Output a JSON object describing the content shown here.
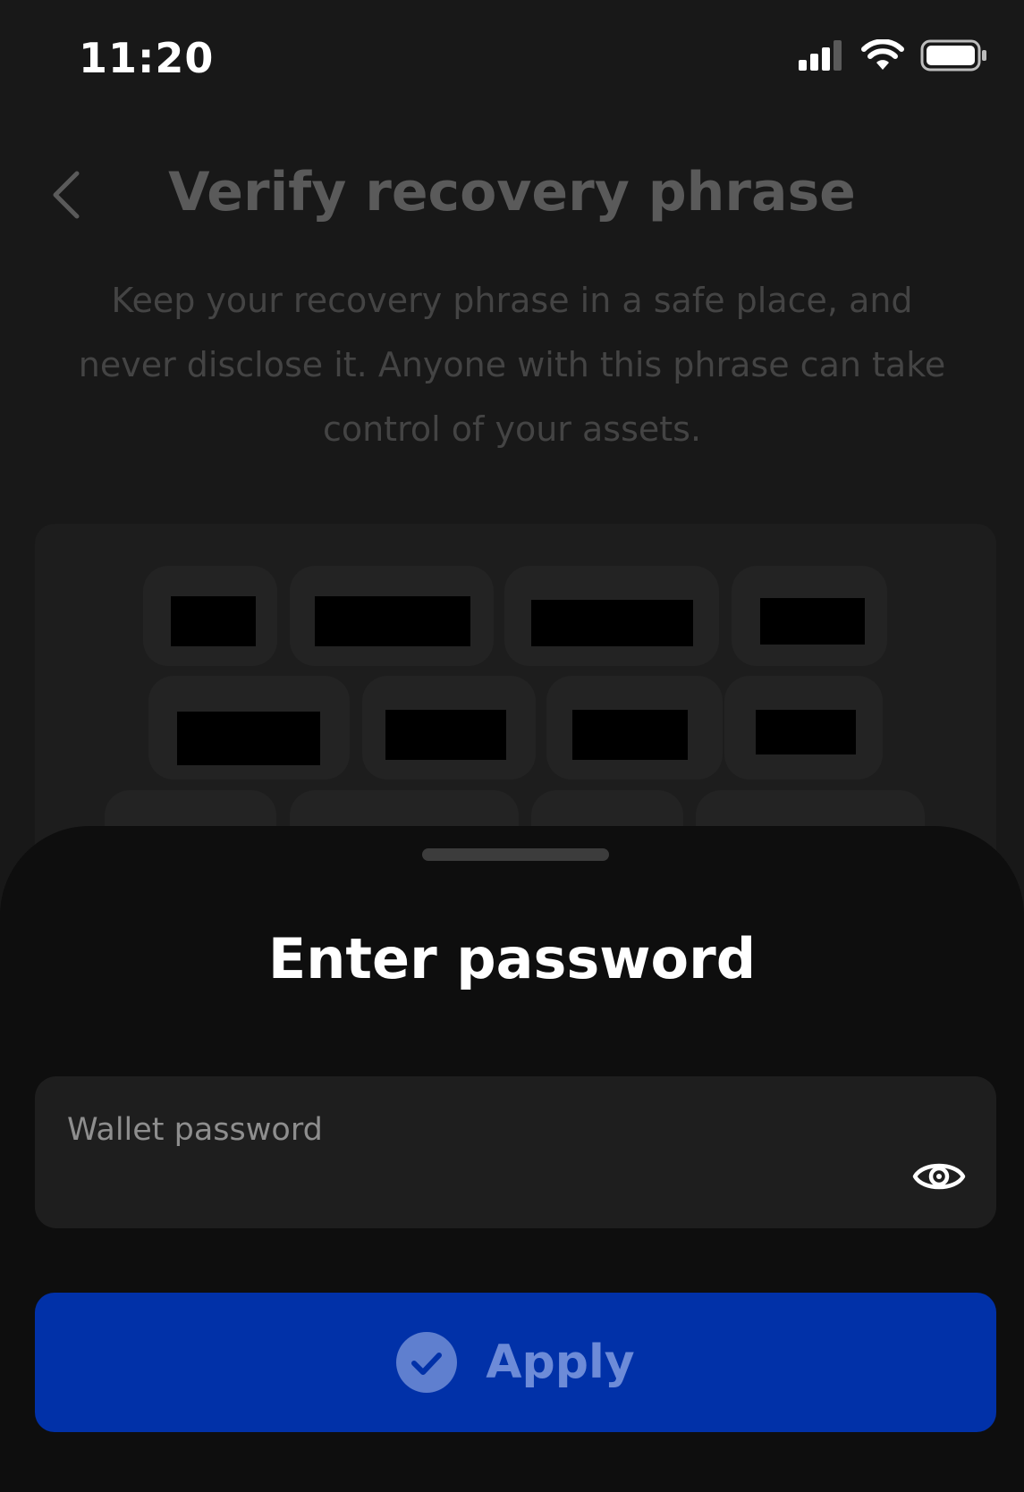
{
  "status_bar": {
    "time": "11:20",
    "icons": [
      "cellular-signal-icon",
      "wifi-icon",
      "battery-icon"
    ]
  },
  "background_screen": {
    "title": "Verify recovery phrase",
    "description": "Keep your recovery phrase in a safe place, and never disclose it. Anyone with this phrase can take control of your assets.",
    "icons": [
      "chevron-left-icon"
    ]
  },
  "sheet": {
    "title": "Enter password",
    "password_field": {
      "placeholder": "Wallet password",
      "value": ""
    },
    "apply_label": "Apply",
    "icons": [
      "eye-icon",
      "check-circle-icon"
    ]
  },
  "colors": {
    "background": "#181818",
    "sheet": "#0e0e0e",
    "field": "#1e1e1e",
    "accent": "#0131a8",
    "accent_text": "#6d8bd8"
  }
}
